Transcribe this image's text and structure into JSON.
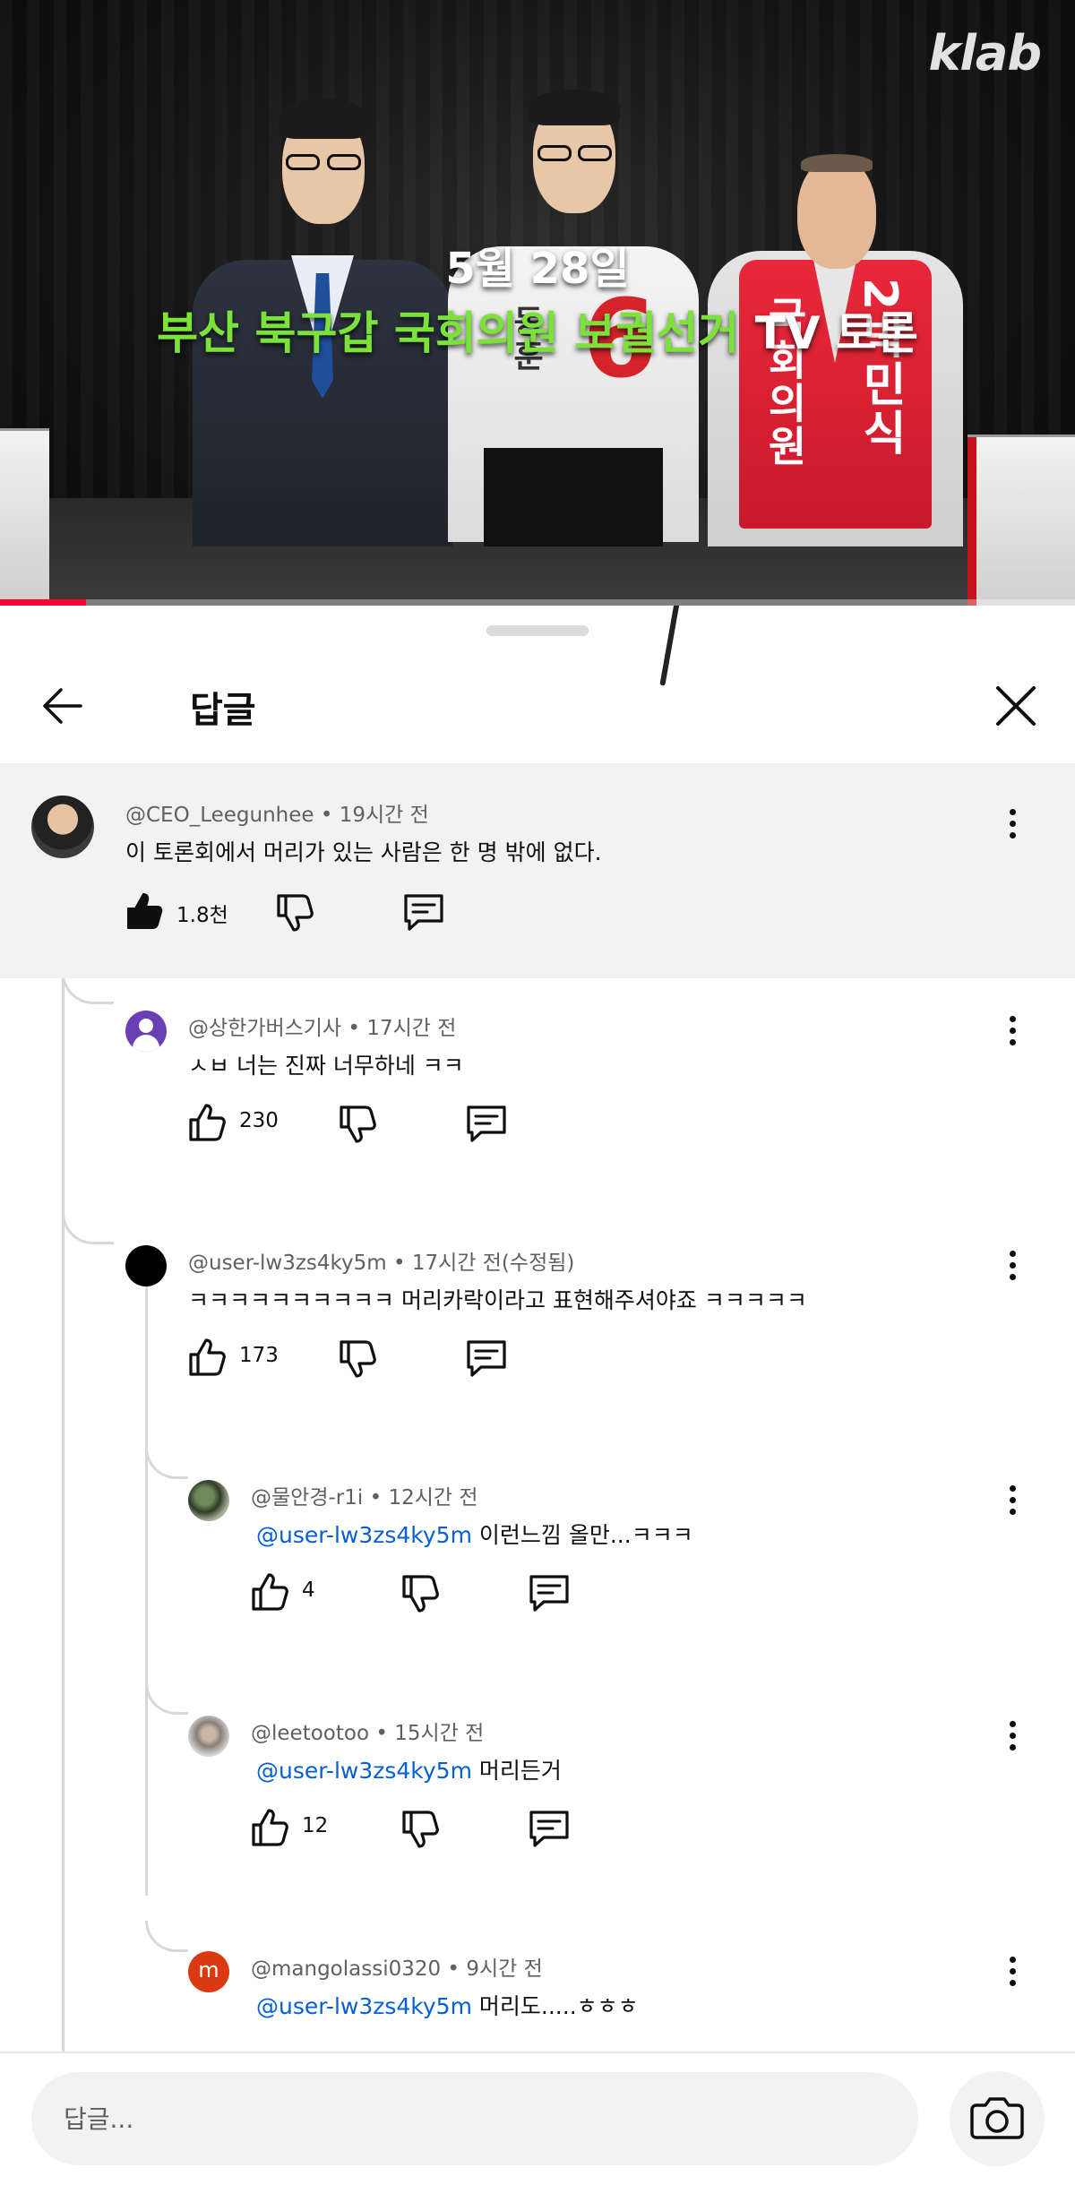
{
  "video": {
    "logo": "klab",
    "caption_date": "5월 28일",
    "caption_title_green": "부산 북구갑 국회의원 보궐선거",
    "caption_title_white": "TV 토론",
    "progress": 0.08,
    "vest_text_1": "국회의원",
    "vest_text_2": "2박민식",
    "sash_text": "동훈"
  },
  "header": {
    "title": "답글"
  },
  "comments": [
    {
      "author": "@CEO_Leegunhee",
      "time": "19시간 전",
      "text": "이 토론회에서 머리가 있는 사람은 한 명 밖에 없다.",
      "likes": "1.8천",
      "liked": true
    },
    {
      "author": "@상한가버스기사",
      "time": "17시간 전",
      "text": "ㅅㅂ 너는 진짜 너무하네 ㅋㅋ",
      "likes": "230",
      "avatar_color": "#6a3fb3"
    },
    {
      "author": "@user-lw3zs4ky5m",
      "time": "17시간 전(수정됨)",
      "text": "ㅋㅋㅋㅋㅋㅋㅋㅋㅋㅋ 머리카락이라고 표현해주셔야죠 ㅋㅋㅋㅋㅋ",
      "likes": "173",
      "avatar_color": "#000000"
    },
    {
      "author": "@물안경-r1i",
      "time": "12시간 전",
      "mention": "@user-lw3zs4ky5m",
      "text": "이런느낌 올만...ㅋㅋㅋ",
      "likes": "4"
    },
    {
      "author": "@leetootoo",
      "time": "15시간 전",
      "mention": "@user-lw3zs4ky5m",
      "text": "머리든거",
      "likes": "12"
    },
    {
      "author": "@mangolassi0320",
      "time": "9시간 전",
      "mention": "@user-lw3zs4ky5m",
      "text": "머리도.....ㅎㅎㅎ",
      "avatar_letter": "m",
      "avatar_color": "#d93a12"
    }
  ],
  "footer": {
    "placeholder": "답글..."
  },
  "colors": {
    "mention": "#065fd4",
    "progress": "#ff0033",
    "caption_green": "#7be23a"
  },
  "icons": [
    "back-arrow-icon",
    "close-icon",
    "like-icon",
    "dislike-icon",
    "reply-icon",
    "more-vert-icon",
    "camera-icon"
  ]
}
